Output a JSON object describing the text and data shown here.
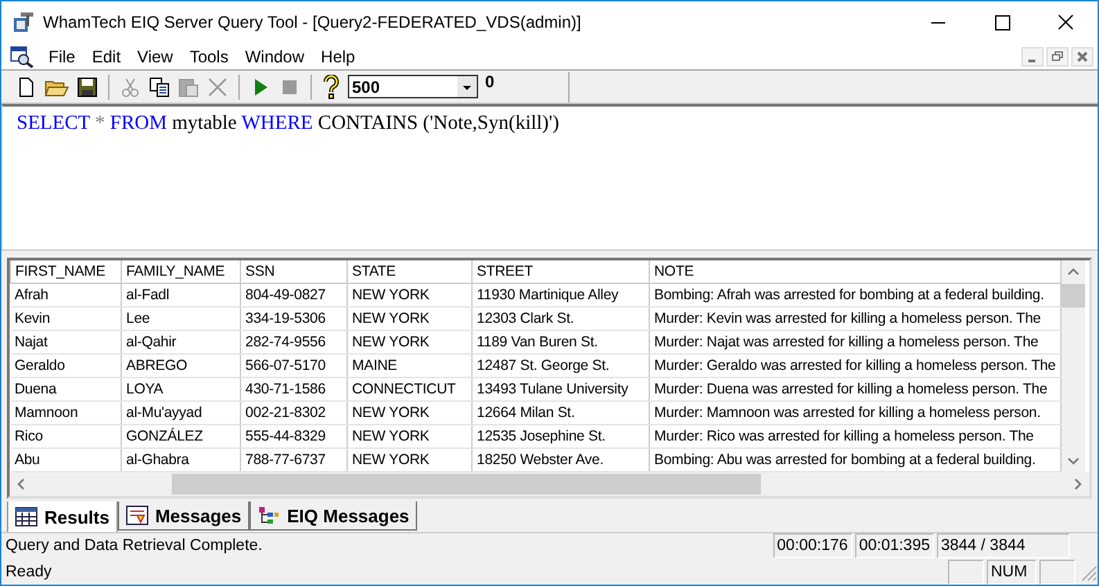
{
  "window": {
    "title": "WhamTech EIQ Server Query Tool - [Query2-FEDERATED_VDS(admin)]"
  },
  "menu": [
    "File",
    "Edit",
    "View",
    "Tools",
    "Window",
    "Help"
  ],
  "toolbar": {
    "row_limit": "500",
    "count": "0"
  },
  "query": [
    {
      "text": "SELECT",
      "kind": "keyword"
    },
    {
      "text": "*",
      "kind": "operator"
    },
    {
      "text": "FROM",
      "kind": "keyword"
    },
    {
      "text": "mytable",
      "kind": "plain"
    },
    {
      "text": "WHERE",
      "kind": "keyword"
    },
    {
      "text": "CONTAINS ('Note,Syn(kill)')",
      "kind": "plain"
    }
  ],
  "table": {
    "columns": [
      "FIRST_NAME",
      "FAMILY_NAME",
      "SSN",
      "STATE",
      "STREET",
      "NOTE"
    ],
    "rows": [
      [
        "Afrah",
        "al-Fadl",
        "804-49-0827",
        "NEW YORK",
        "11930 Martinique Alley",
        "Bombing: Afrah was arrested for bombing at a federal building."
      ],
      [
        "Kevin",
        "Lee",
        "334-19-5306",
        "NEW YORK",
        "12303 Clark St.",
        "Murder: Kevin was arrested for killing a homeless person. The"
      ],
      [
        "Najat",
        "al-Qahir",
        "282-74-9556",
        "NEW YORK",
        "1189 Van Buren St.",
        "Murder: Najat was arrested for killing a homeless person. The"
      ],
      [
        "Geraldo",
        "ABREGO",
        "566-07-5170",
        "MAINE",
        "12487 St. George St.",
        "Murder: Geraldo was arrested for killing a homeless person. The"
      ],
      [
        "Duena",
        "LOYA",
        "430-71-1586",
        "CONNECTICUT",
        "13493 Tulane University",
        "Murder: Duena was arrested for killing a homeless person. The"
      ],
      [
        "Mamnoon",
        "al-Mu'ayyad",
        "002-21-8302",
        "NEW YORK",
        "12664 Milan St.",
        "Murder: Mamnoon was arrested for killing a homeless person."
      ],
      [
        "Rico",
        "GONZÁLEZ",
        "555-44-8329",
        "NEW YORK",
        "12535 Josephine St.",
        "Murder: Rico was arrested for killing a homeless person. The"
      ],
      [
        "Abu",
        "al-Ghabra",
        "788-77-6737",
        "NEW YORK",
        "18250 Webster Ave.",
        "Bombing: Abu was arrested for bombing at a federal building."
      ]
    ]
  },
  "tabs": [
    {
      "label": "Results",
      "selected": true,
      "kind": "grid"
    },
    {
      "label": "Messages",
      "selected": false,
      "kind": "messages"
    },
    {
      "label": "EIQ Messages",
      "selected": false,
      "kind": "tree"
    }
  ],
  "status": {
    "message": "Query and Data Retrieval Complete.",
    "time_1": "00:00:176",
    "time_2": "00:01:395",
    "rows": "3844 / 3844"
  },
  "status_bar": {
    "text": "Ready",
    "num": "NUM"
  }
}
